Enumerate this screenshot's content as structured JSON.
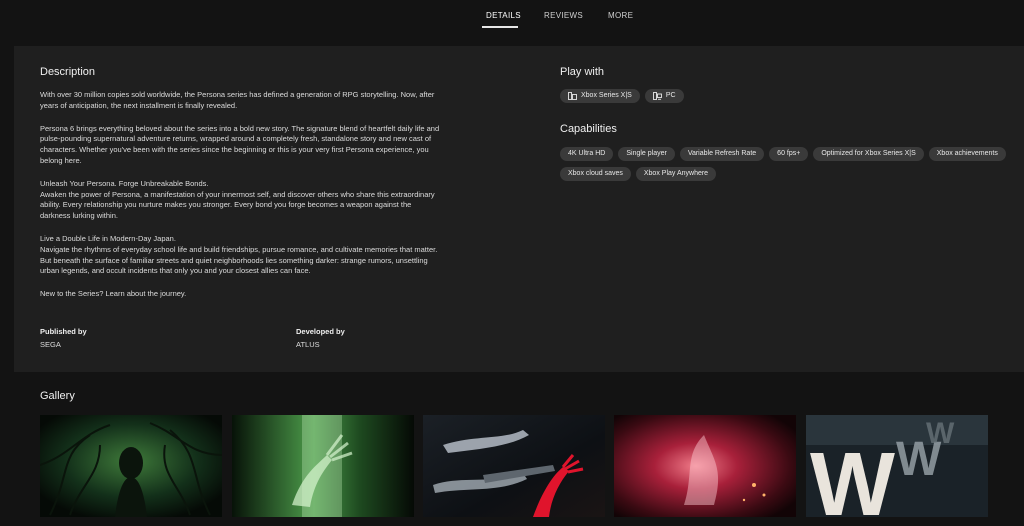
{
  "tabs": [
    {
      "label": "DETAILS",
      "active": true
    },
    {
      "label": "REVIEWS",
      "active": false
    },
    {
      "label": "MORE",
      "active": false
    }
  ],
  "description": {
    "title": "Description",
    "paragraphs": [
      "With over 30 million copies sold worldwide, the Persona series has defined a generation of RPG storytelling. Now, after years of anticipation, the next installment is finally revealed.",
      "Persona 6 brings everything beloved about the series into a bold new story. The signature blend of heartfelt daily life and pulse-pounding supernatural adventure returns, wrapped around a completely fresh, standalone story and new cast of characters. Whether you've been with the series since the beginning or this is your very first Persona experience, you belong here.",
      "Unleash Your Persona. Forge Unbreakable Bonds.\nAwaken the power of Persona, a manifestation of your innermost self, and discover others who share this extraordinary ability. Every relationship you nurture makes you stronger. Every bond you forge becomes a weapon against the darkness lurking within.",
      "Live a Double Life in Modern-Day Japan.\nNavigate the rhythms of everyday school life and build friendships, pursue romance, and cultivate memories that matter. But beneath the surface of familiar streets and quiet neighborhoods lies something darker: strange rumors, unsettling urban legends, and occult incidents that only you and your closest allies can face.",
      "New to the Series? Learn about the journey."
    ]
  },
  "credits": {
    "published_label": "Published by",
    "published_value": "SEGA",
    "developed_label": "Developed by",
    "developed_value": "ATLUS"
  },
  "play_with": {
    "title": "Play with",
    "platforms": [
      {
        "label": "Xbox Series X|S",
        "icon": "console-icon"
      },
      {
        "label": "PC",
        "icon": "pc-icon"
      }
    ]
  },
  "capabilities": {
    "title": "Capabilities",
    "items": [
      "4K Ultra HD",
      "Single player",
      "Variable Refresh Rate",
      "60 fps+",
      "Optimized for Xbox Series X|S",
      "Xbox achievements",
      "Xbox cloud saves",
      "Xbox Play Anywhere"
    ]
  },
  "gallery": {
    "title": "Gallery",
    "images": [
      {
        "icon": "green-vines-figure-image"
      },
      {
        "icon": "green-ghost-hand-image"
      },
      {
        "icon": "reaching-hands-red-image"
      },
      {
        "icon": "red-flame-image"
      },
      {
        "icon": "w-letters-image"
      }
    ]
  },
  "colors": {
    "background": "#131313",
    "panel": "#1f1f1f",
    "chip": "#3a3a3a"
  }
}
